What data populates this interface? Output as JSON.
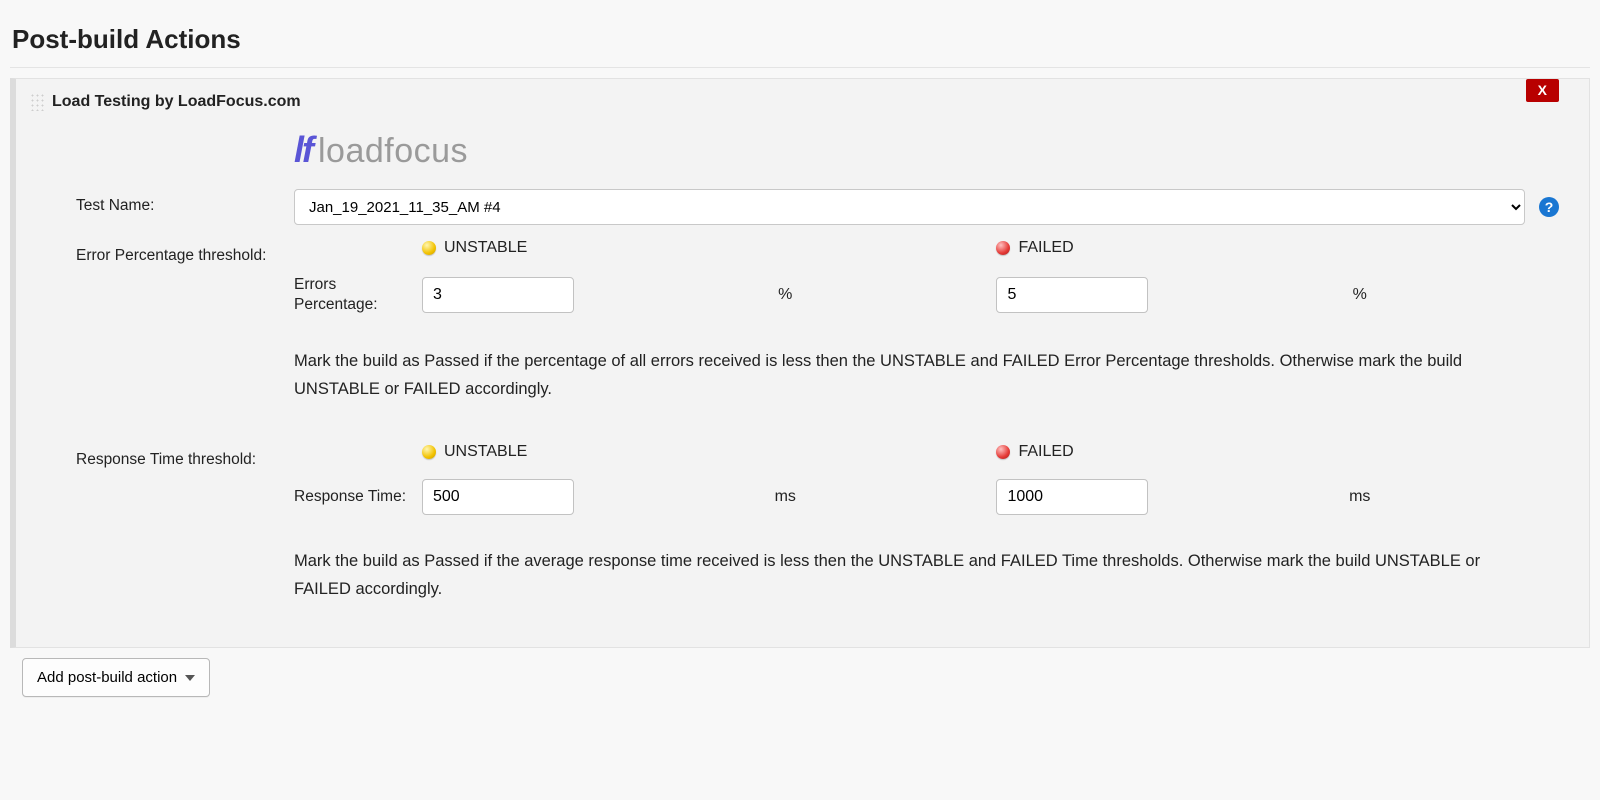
{
  "section_title": "Post-build Actions",
  "block_title": "Load Testing by LoadFocus.com",
  "close_label": "X",
  "logo_prefix": "lf",
  "logo_text": "loadfocus",
  "test_name": {
    "label": "Test Name:",
    "value": "Jan_19_2021_11_35_AM #4"
  },
  "status": {
    "unstable": "UNSTABLE",
    "failed": "FAILED"
  },
  "error_threshold": {
    "label": "Error Percentage threshold:",
    "sublabel": "Errors Percentage:",
    "unstable_value": "3",
    "failed_value": "5",
    "unit": "%",
    "description": "Mark the build as Passed if the percentage of all errors received is less then the UNSTABLE and FAILED Error Percentage thresholds. Otherwise mark the build UNSTABLE or FAILED accordingly."
  },
  "response_threshold": {
    "label": "Response Time threshold:",
    "sublabel": "Response Time:",
    "unstable_value": "500",
    "failed_value": "1000",
    "unit": "ms",
    "description": "Mark the build as Passed if the average response time received is less then the UNSTABLE and FAILED Time thresholds. Otherwise mark the build UNSTABLE or FAILED accordingly."
  },
  "help_tooltip": "?",
  "add_button": "Add post-build action"
}
